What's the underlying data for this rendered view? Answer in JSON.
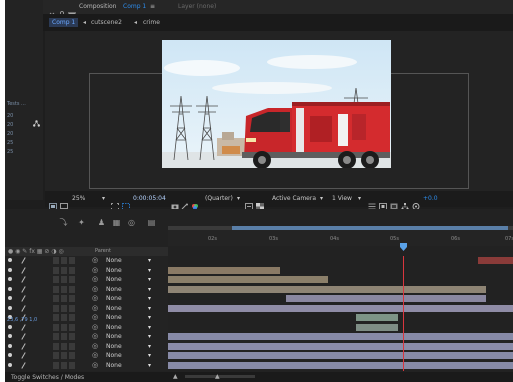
{
  "project_panel": {
    "lines": [
      "Tests ...",
      "20",
      "20",
      "20",
      "25",
      "25"
    ]
  },
  "composition_panel": {
    "tab_label": "Composition",
    "tab_comp_name": "Comp 1",
    "tab_close": "≡",
    "layer_tab": "Layer (none)",
    "breadcrumbs": [
      "Comp 1",
      "cutscene2",
      "crime"
    ],
    "crumb_separator": "◂"
  },
  "viewer_toolbar": {
    "zoom": "25%",
    "timecode": "0:00:05:04",
    "resolution": "(Quarter)",
    "camera": "Active Camera",
    "views": "1 View",
    "exposure": "+0.0",
    "colors": {
      "accent": "#2d8ceb"
    }
  },
  "timeline": {
    "ruler_ticks": [
      "02s",
      "03s",
      "04s",
      "05s",
      "06s",
      "07s"
    ],
    "header": {
      "parent_label": "Parent"
    },
    "timecode_label": "23,6 ,79 1,0",
    "playhead_time": "05s",
    "layers": [
      {
        "parent": "None",
        "bar_color": "#8a3b39"
      },
      {
        "parent": "None",
        "bar_color": "#8a7a65"
      },
      {
        "parent": "None",
        "bar_color": "#8b7f6a"
      },
      {
        "parent": "None",
        "bar_color": "#8e8474"
      },
      {
        "parent": "None",
        "bar_color": "#8a87a0"
      },
      {
        "parent": "None",
        "bar_color": "#8f8ca6"
      },
      {
        "parent": "None",
        "bar_color": "#7d9486"
      },
      {
        "parent": "None",
        "bar_color": "#7e8d85"
      },
      {
        "parent": "None",
        "bar_color": "#878aa7"
      },
      {
        "parent": "None",
        "bar_color": "#8a8ba8"
      },
      {
        "parent": "None",
        "bar_color": "#878aa7"
      },
      {
        "parent": "None",
        "bar_color": "#878aa7"
      }
    ],
    "status_left": "Toggle Switches / Modes"
  }
}
